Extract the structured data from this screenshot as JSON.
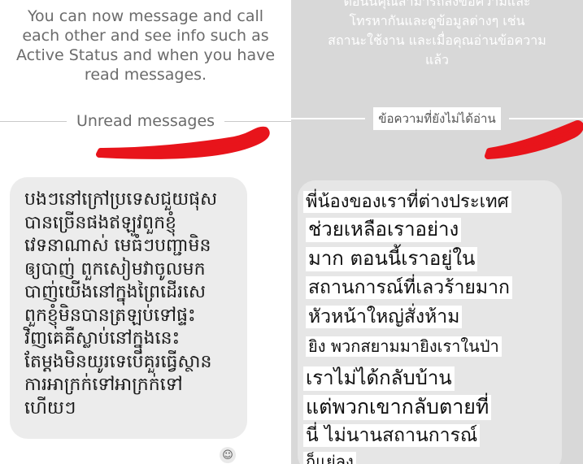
{
  "left_panel": {
    "notice": "You can now message and call\neach other and see info such as\nActive Status and when you have\nread messages.",
    "divider_label": "Unread messages",
    "message_text": "បងៗនៅក្រៅប្រទេសជួយផុស\nបានច្រើនផងឥឡូវពួកខ្ញុំ\nវេទនាណាស់ មេធំៗបញ្ជាមិន\nឲ្យបាញ់ ពួកសៀមវាចូលមក\nបាញ់យើងនៅក្នុងព្រៃដើរសេ\nពួកខ្ញុំមិនបានត្រឡប់ទៅផ្ទះ\nវិញគេគឺស្លាប់នៅក្នុងនេះ\nតែម្ដងមិនយូរទេបើគួរធ្វើស្ថាន\nការអាក្រក់ទៅអាក្រក់ទៅ\nហើយៗ",
    "reaction_icon": "add-reaction-icon"
  },
  "right_panel": {
    "notice": "ตอนนี้คุณสามารถส่งข้อความและ\nโทรหากันและดูข้อมูลต่างๆ เช่น\nสถานะใช้งาน และเมื่อคุณอ่านข้อความ\nแล้ว",
    "divider_label": "ข้อความที่ยังไม่ได้อ่าน",
    "translation_lines": [
      "พี่น้องของเราที่ต่างประเทศ",
      "ช่วยเหลือเราอย่าง",
      "มาก ตอนนี้เราอยู่ใน",
      "สถานการณ์ที่เลวร้ายมาก",
      "หัวหน้าใหญ่สั่งห้าม",
      "ยิง พวกสยามมายิงเราในป่า",
      "เราไม่ได้กลับบ้าน",
      "แต่พวกเขากลับตายที่",
      "นี่ ไม่นานสถานการณ์",
      "ก็แย่ลง"
    ]
  },
  "colors": {
    "annotation_red": "#e8141b",
    "bubble_gray": "#ececec",
    "right_background": "#d8d8d8"
  }
}
